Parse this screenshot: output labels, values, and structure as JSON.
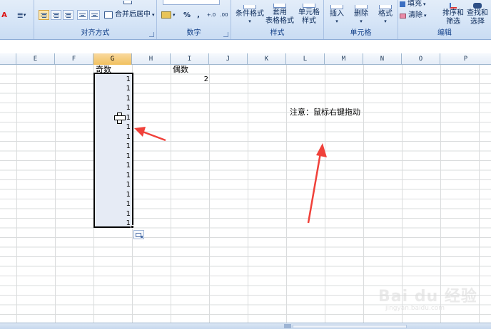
{
  "ribbon": {
    "groups": [
      {
        "label": "对齐方式"
      },
      {
        "label": "数字"
      },
      {
        "label": "样式"
      },
      {
        "label": "单元格"
      },
      {
        "label": "编辑"
      }
    ],
    "merge_center": "合并后居中",
    "percent": "%",
    "comma": ",",
    "conditional_format": "条件格式",
    "table_format_line1": "套用",
    "table_format_line2": "表格格式",
    "cell_style_line1": "单元格",
    "cell_style_line2": "样式",
    "insert": "插入",
    "delete": "删除",
    "format": "格式",
    "fill": "填充",
    "clear": "清除",
    "sort_filter_line1": "排序和",
    "sort_filter_line2": "筛选",
    "find_select_line1": "查找和",
    "find_select_line2": "选择",
    "decimal_inc": "+.0",
    "decimal_dec": ".00"
  },
  "columns": [
    "E",
    "F",
    "G",
    "H",
    "I",
    "J",
    "K",
    "L",
    "M",
    "N",
    "O",
    "P"
  ],
  "selected_column": "G",
  "cells": {
    "g_header": "奇数",
    "i_header": "偶数",
    "i_value": "2",
    "note": "注意：鼠标右键拖动",
    "g_values": [
      "1",
      "1",
      "1",
      "1",
      "1",
      "1",
      "1",
      "1",
      "1",
      "1",
      "1",
      "1",
      "1",
      "1",
      "1",
      "1"
    ]
  },
  "watermark": {
    "main": "Bai du 经验",
    "sub": "jingyan.baidu.com"
  },
  "colors": {
    "arrow": "#f0413a",
    "selection_fill": "#e6ebf5",
    "header_selected": "#f1c15f"
  }
}
